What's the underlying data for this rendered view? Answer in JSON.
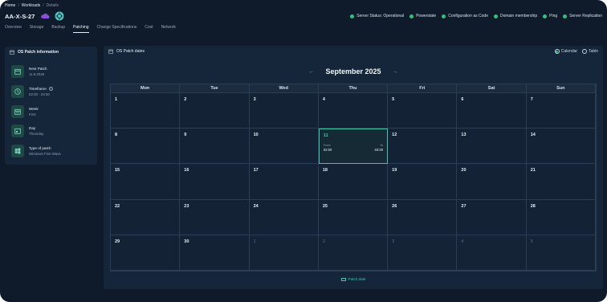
{
  "breadcrumb": {
    "home": "Home",
    "workloads": "Workloads",
    "current": "Details",
    "sep": "/"
  },
  "server": {
    "name": "AA-X-S-27"
  },
  "status": [
    {
      "label": "Server Status: Operational",
      "color": "#2ec27e"
    },
    {
      "label": "Powerstate",
      "color": "#2ec27e"
    },
    {
      "label": "Configuration as Code",
      "color": "#2ec27e"
    },
    {
      "label": "Domain membership",
      "color": "#2ec27e"
    },
    {
      "label": "Ping",
      "color": "#2ec27e"
    },
    {
      "label": "Server Replication",
      "color": "#2ec27e"
    }
  ],
  "tabs": [
    {
      "label": "Overview",
      "active": false
    },
    {
      "label": "Storage",
      "active": false
    },
    {
      "label": "Backup",
      "active": false
    },
    {
      "label": "Patching",
      "active": true
    },
    {
      "label": "Change Specifications",
      "active": false
    },
    {
      "label": "Cost",
      "active": false
    },
    {
      "label": "Network",
      "active": false
    }
  ],
  "info_card": {
    "title": "OS Patch information",
    "items": [
      {
        "label": "Next Patch",
        "value": "11.9.2025",
        "icon": "calendar-icon"
      },
      {
        "label": "Timeframe",
        "value": "02:00 - 03:00",
        "icon": "clock-icon",
        "help": "?"
      },
      {
        "label": "Week",
        "value": "First",
        "icon": "calendar-week-icon"
      },
      {
        "label": "Day",
        "value": "Thursday",
        "icon": "calendar-day-icon"
      },
      {
        "label": "Type of patch",
        "value": "Windows First Wave",
        "icon": "windows-icon"
      }
    ]
  },
  "calendar": {
    "title": "OS Patch dates",
    "view_options": [
      {
        "label": "Calendar",
        "selected": true
      },
      {
        "label": "Table",
        "selected": false
      }
    ],
    "month_label": "September 2025",
    "prev_arrow": "←",
    "next_arrow": "→",
    "weekdays": [
      "Mon",
      "Tue",
      "Wed",
      "Thu",
      "Fri",
      "Sat",
      "Sun"
    ],
    "days": [
      {
        "n": "1"
      },
      {
        "n": "2"
      },
      {
        "n": "3"
      },
      {
        "n": "4"
      },
      {
        "n": "5"
      },
      {
        "n": "6"
      },
      {
        "n": "7"
      },
      {
        "n": "8"
      },
      {
        "n": "9"
      },
      {
        "n": "10"
      },
      {
        "n": "11",
        "patch": true,
        "from_label": "From",
        "from": "02:00",
        "to_label": "To",
        "to": "03:00"
      },
      {
        "n": "12"
      },
      {
        "n": "13"
      },
      {
        "n": "14"
      },
      {
        "n": "15"
      },
      {
        "n": "16"
      },
      {
        "n": "17"
      },
      {
        "n": "18"
      },
      {
        "n": "19"
      },
      {
        "n": "20"
      },
      {
        "n": "21"
      },
      {
        "n": "22"
      },
      {
        "n": "23"
      },
      {
        "n": "24"
      },
      {
        "n": "25"
      },
      {
        "n": "26"
      },
      {
        "n": "27"
      },
      {
        "n": "28"
      },
      {
        "n": "29"
      },
      {
        "n": "30"
      },
      {
        "n": "1",
        "other": true
      },
      {
        "n": "2",
        "other": true
      },
      {
        "n": "3",
        "other": true
      },
      {
        "n": "4",
        "other": true
      },
      {
        "n": "5",
        "other": true
      }
    ],
    "legend": "Patch date"
  },
  "colors": {
    "accent": "#3fc6b2",
    "status_ok": "#2ec27e",
    "background": "#0f1b2a",
    "card": "#16263a"
  }
}
